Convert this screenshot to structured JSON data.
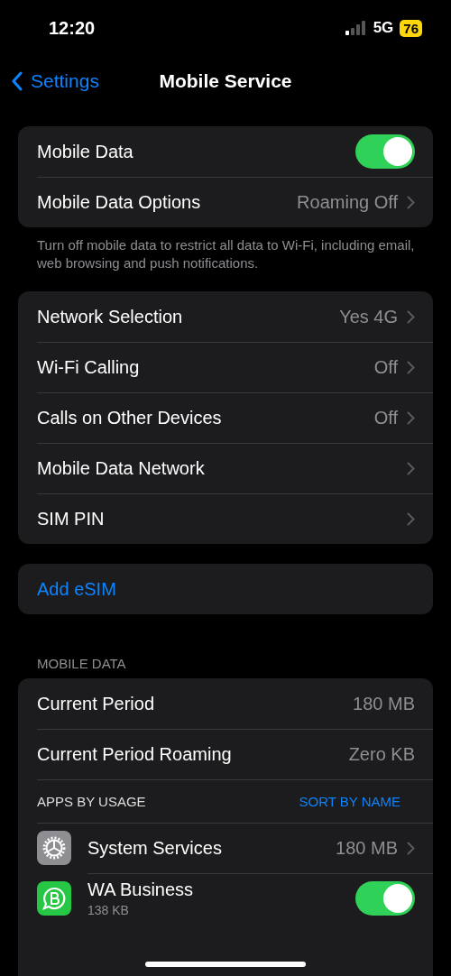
{
  "status_bar": {
    "time": "12:20",
    "network": "5G",
    "battery": "76"
  },
  "nav": {
    "back": "Settings",
    "title": "Mobile Service"
  },
  "groups": [
    {
      "rows": [
        {
          "kind": "toggle",
          "label": "Mobile Data",
          "on": true
        },
        {
          "kind": "link",
          "label": "Mobile Data Options",
          "value": "Roaming Off"
        }
      ],
      "footer": "Turn off mobile data to restrict all data to Wi-Fi, including email, web browsing and push notifications."
    },
    {
      "rows": [
        {
          "kind": "link",
          "label": "Network Selection",
          "value": "Yes 4G"
        },
        {
          "kind": "link",
          "label": "Wi-Fi Calling",
          "value": "Off"
        },
        {
          "kind": "link",
          "label": "Calls on Other Devices",
          "value": "Off"
        },
        {
          "kind": "link",
          "label": "Mobile Data Network"
        },
        {
          "kind": "link",
          "label": "SIM PIN"
        }
      ]
    },
    {
      "rows": [
        {
          "kind": "action",
          "label": "Add eSIM"
        }
      ]
    },
    {
      "header": "MOBILE DATA",
      "rows": [
        {
          "kind": "value",
          "label": "Current Period",
          "value": "180 MB"
        },
        {
          "kind": "value",
          "label": "Current Period Roaming",
          "value": "Zero KB"
        },
        {
          "kind": "subheader",
          "label": "APPS BY USAGE",
          "action": "SORT BY NAME"
        },
        {
          "kind": "app",
          "label": "System Services",
          "value": "180 MB"
        },
        {
          "kind": "app_toggle",
          "label": "WA Business",
          "detail": "138 KB",
          "on": true
        }
      ]
    }
  ]
}
